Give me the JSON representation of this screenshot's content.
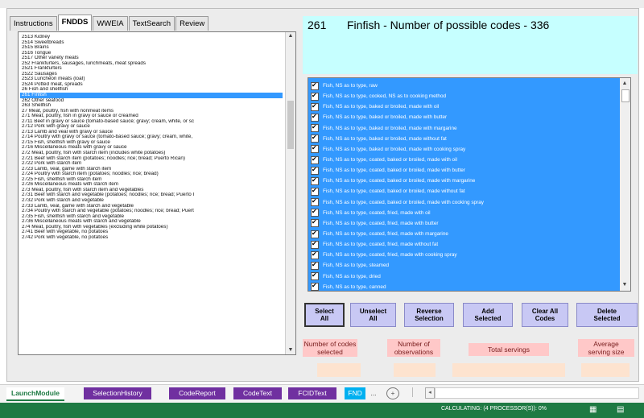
{
  "tabs": [
    "Instructions",
    "FNDDS",
    "WWEIA",
    "TextSearch",
    "Review"
  ],
  "left_list": [
    "2513 Kidney",
    "2514 Sweetbreads",
    "2515 Brains",
    "2516 Tongue",
    "2517 Other variety meats",
    "252 Frankfurters, sausages, lunchmeats, meat spreads",
    "2521 Frankfurters",
    "2522 Sausages",
    "2523 Luncheon meats (loaf)",
    "2524 Potted meat, spreads",
    "26 Fish and shellfish",
    "261 Finfish",
    "262 Other seafood",
    "263 Shellfish",
    "27 Meat, poultry, fish with nonmeat items",
    "271 Meat, poultry, fish in gravy or sauce or creamed",
    "2711 Beef in gravy or sauce (tomato-based sauce; gravy; cream, white, or sc",
    "2712 Pork with gravy or sauce",
    "2713 Lamb and veal with gravy or sauce",
    "2714 Poultry with gravy or sauce (tomato-based sauce; gravy; cream, white,",
    "2715 Fish, shellfish with gravy or sauce",
    "2716 Miscellaneous meats with gravy or sauce",
    "272 Meat, poultry, fish with starch item (includes white potatoes)",
    "2721 Beef with starch item (potatoes; noodles; rice; bread; Puerto Rican)",
    "2722 Pork with starch item",
    "2723 Lamb, veal, game with starch item",
    "2724 Poultry with starch item (potatoes; noodles; rice; bread)",
    "2725 Fish, shellfish with starch item",
    "2726 Miscellaneous meats with starch item",
    "273 Meat, poultry, fish with starch item and vegetables",
    "2731 Beef with starch and vegetable (potatoes; noodles; rice; bread; Puerto I",
    "2732 Pork with starch and vegetable",
    "2733 Lamb, veal, game with starch and vegetable",
    "2734 Poultry with starch and vegetable (potatoes; noodles; rice; bread; Puert",
    "2735 Fish, shellfish with starch and vegetable",
    "2736 Miscellaneous meats with starch and vegetable",
    "274 Meat, poultry, fish with vegetables (excluding white potatoes)",
    "2741 Beef with vegetable, no potatoes",
    "2742 Pork with vegetable, no potatoes"
  ],
  "left_selected_index": 11,
  "title": {
    "code": "261",
    "text": "Finfish - Number of possible codes - 336"
  },
  "right_list": [
    "Fish, NS as to type, raw",
    "Fish, NS as to type, cooked, NS as to cooking method",
    "Fish, NS as to type, baked or broiled, made with oil",
    "Fish, NS as to type, baked or broiled, made with butter",
    "Fish, NS as to type, baked or broiled, made with margarine",
    "Fish, NS as to type, baked or broiled, made without fat",
    "Fish, NS as to type, baked or broiled, made with cooking spray",
    "Fish, NS as to type, coated, baked or broiled, made with oil",
    "Fish, NS as to type, coated, baked or broiled, made with butter",
    "Fish, NS as to type, coated, baked or broiled, made with margarine",
    "Fish, NS as to type, coated, baked or broiled, made without fat",
    "Fish, NS as to type, coated, baked or broiled, made with cooking spray",
    "Fish, NS as to type, coated, fried, made with oil",
    "Fish, NS as to type, coated, fried, made with butter",
    "Fish, NS as to type, coated, fried, made with margarine",
    "Fish, NS as to type, coated, fried, made without fat",
    "Fish, NS as to type, coated, fried, made with cooking spray",
    "Fish, NS as to type, steamed",
    "Fish, NS as to type, dried",
    "Fish, NS as to type, canned"
  ],
  "buttons": [
    {
      "line1": "Select",
      "line2": "All"
    },
    {
      "line1": "Unselect",
      "line2": "All"
    },
    {
      "line1": "Reverse",
      "line2": "Selection"
    },
    {
      "line1": "Add",
      "line2": "Selected"
    },
    {
      "line1": "Clear All",
      "line2": "Codes"
    },
    {
      "line1": "Delete",
      "line2": "Selected"
    }
  ],
  "stats_labels": [
    {
      "line1": "Number of codes",
      "line2": "selected"
    },
    {
      "line1": "Number of",
      "line2": "observations"
    },
    {
      "line1": "Total servings",
      "line2": ""
    },
    {
      "line1": "Average",
      "line2": "serving size"
    }
  ],
  "sheet_tabs": [
    "LaunchModule",
    "SelectionHistory",
    "CodeReport",
    "CodeText",
    "FCIDText",
    "FND"
  ],
  "sheet_more": "...",
  "status": "CALCULATING: (4 PROCESSOR(S)): 0%"
}
